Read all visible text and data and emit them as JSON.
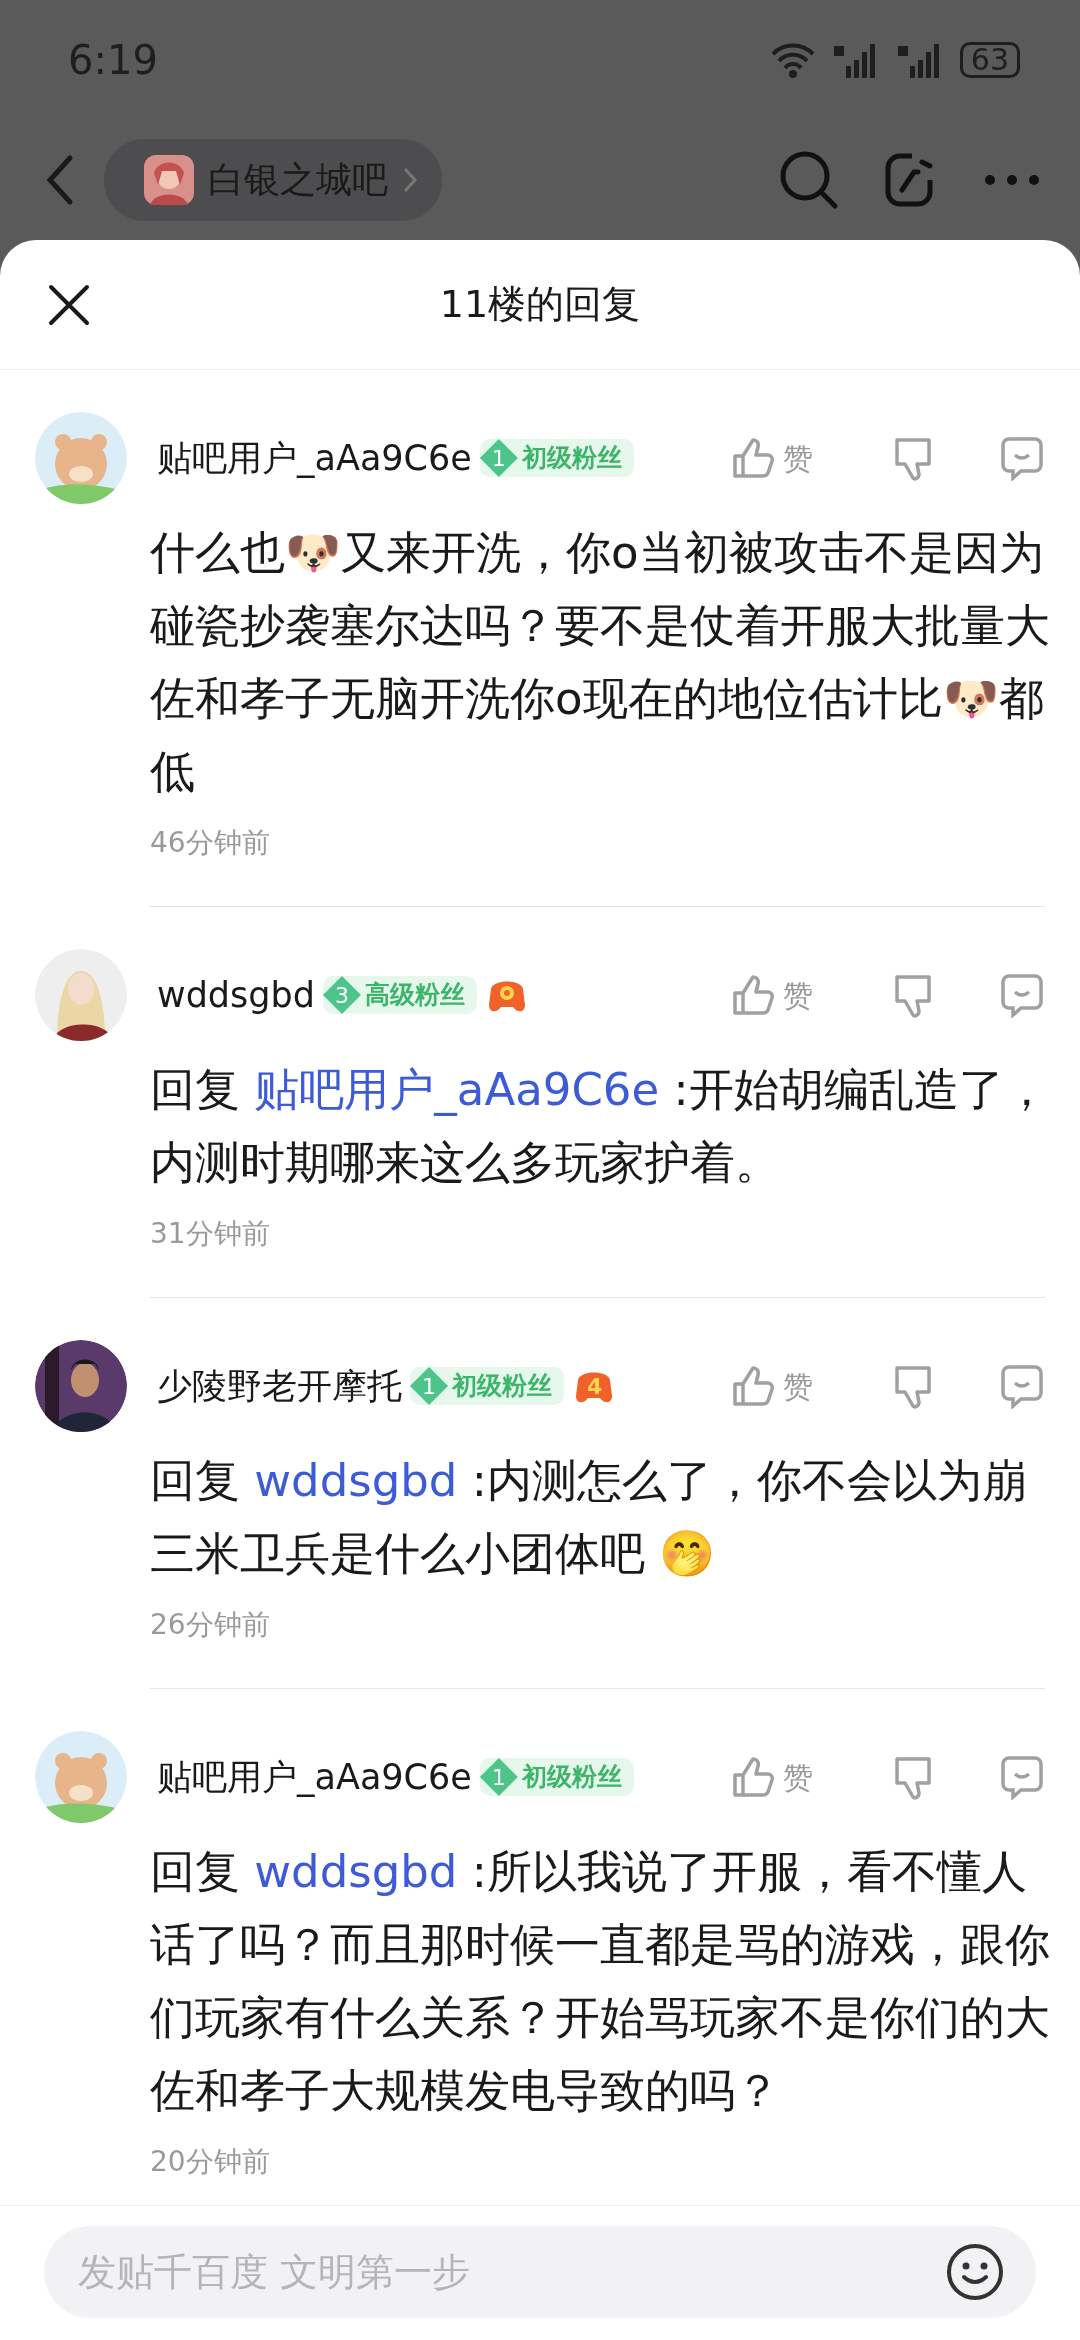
{
  "status_bar": {
    "time": "6:19",
    "battery": "63"
  },
  "top_bar": {
    "forum": "白银之城吧"
  },
  "sheet": {
    "title": "11楼的回复"
  },
  "comments": [
    {
      "user": "贴吧用户_aAa9C6e",
      "level": "1",
      "rank": "初级粉丝",
      "like": "赞",
      "text": "什么也🐶又来开洗，你o当初被攻击不是因为碰瓷抄袭塞尔达吗？要不是仗着开服大批量大佐和孝子无脑开洗你o现在的地位估计比🐶都低",
      "time": "46分钟前"
    },
    {
      "user": "wddsgbd",
      "level": "3",
      "rank": "高级粉丝",
      "game_badge": {
        "kind": "ring"
      },
      "like": "赞",
      "reply_prefix": "回复",
      "reply_to": "贴吧用户_aAa9C6e",
      "text": ":开始胡编乱造了，内测时期哪来这么多玩家护着。",
      "time": "31分钟前"
    },
    {
      "user": "少陵野老开摩托",
      "level": "1",
      "rank": "初级粉丝",
      "game_badge": {
        "kind": "number",
        "number": "4"
      },
      "like": "赞",
      "reply_prefix": "回复",
      "reply_to": "wddsgbd",
      "text": ":内测怎么了，你不会以为崩三米卫兵是什么小团体吧 🤭",
      "time": "26分钟前"
    },
    {
      "user": "贴吧用户_aAa9C6e",
      "level": "1",
      "rank": "初级粉丝",
      "like": "赞",
      "reply_prefix": "回复",
      "reply_to": "wddsgbd",
      "text": ":所以我说了开服，看不懂人话了吗？而且那时候一直都是骂的游戏，跟你们玩家有什么关系？开始骂玩家不是你们的大佐和孝子大规模发电导致的吗？",
      "time": "20分钟前"
    }
  ],
  "composer": {
    "placeholder": "发贴千百度 文明第一步"
  }
}
